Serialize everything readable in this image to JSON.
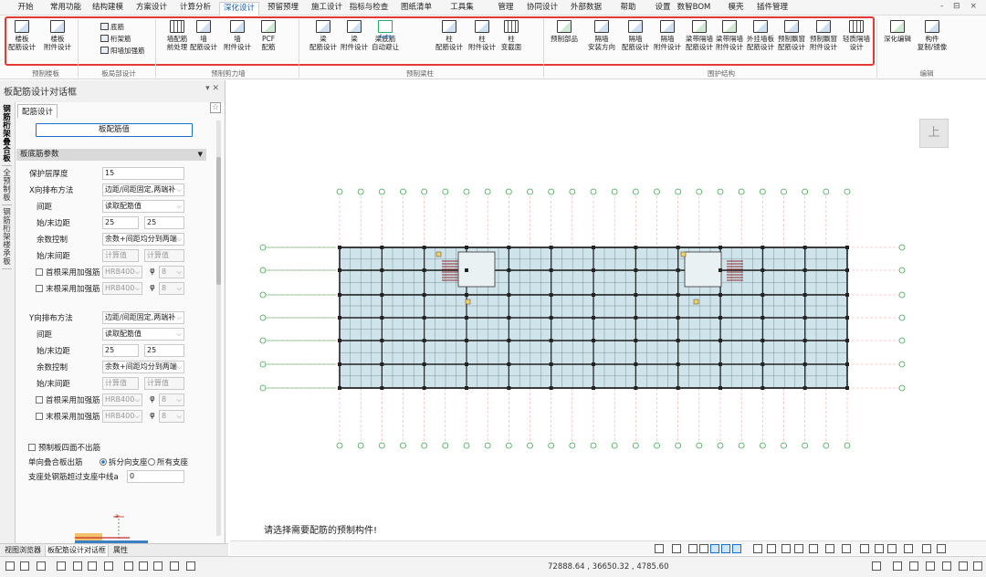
{
  "menu": {
    "tabs": [
      "开始",
      "常用功能",
      "结构建模",
      "方案设计",
      "计算分析",
      "深化设计",
      "预留预埋",
      "施工设计",
      "指标与检查",
      "图纸清单",
      "工具集",
      "管理",
      "协同设计",
      "外部数据",
      "帮助",
      "设置",
      "数智BOM",
      "模壳",
      "插件管理"
    ],
    "active_index": 5
  },
  "ribbon": {
    "buttons": [
      "楼板\n配筋设计",
      "楼板\n附件设计",
      "墙配筋\n前处理",
      "墙\n配筋设计",
      "墙\n附件设计",
      "PCF\n配筋",
      "梁\n配筋设计",
      "梁\n附件设计",
      "梁底筋\n自动避让",
      "柱\n配筋设计",
      "柱\n附件设计",
      "柱\n变截面",
      "预制部品",
      "隔墙\n安装方向",
      "隔墙\n配筋设计",
      "隔墙\n附件设计",
      "梁带隔墙\n配筋设计",
      "梁带隔墙\n附件设计",
      "外挂墙板\n配筋设计",
      "预制飘窗\n配筋设计",
      "预制飘窗\n附件设计",
      "轻质隔墙\n设计",
      "深化编辑",
      "构件\n复制/镜像"
    ],
    "small_buttons": [
      "底筋",
      "桁架筋",
      "阳墙加强筋"
    ],
    "auto_badge": "Auto",
    "groups": [
      "预制楼板",
      "板局部设计",
      "预制剪力墙",
      "预制梁柱",
      "围护结构",
      "编辑"
    ]
  },
  "panel": {
    "title": "板配筋设计对话框",
    "vertical_tabs": [
      "钢筋桁架叠合板",
      "全预制板",
      "钢筋桁架楼承板"
    ],
    "subtab": "配筋设计",
    "top_button": "板配筋值",
    "section": "板底筋参数",
    "fields": {
      "cover_label": "保护层厚度",
      "cover_value": "15",
      "x_method_label": "X向排布方法",
      "x_method_value": "边距/间距固定,两端补",
      "x_spacing_label": "间距",
      "x_spacing_value": "读取配筋值",
      "x_edge_label": "始/末边距",
      "x_edge_start": "25",
      "x_edge_end": "25",
      "x_rem_label": "余数控制",
      "x_rem_value": "余数+间距均分到两端",
      "x_se_spacing_label": "始/末间距",
      "x_se_spacing_a": "计算值",
      "x_se_spacing_b": "计算值",
      "x_first_label": "首根采用加强筋",
      "x_first_grade": "HRB400",
      "x_first_dia": "8",
      "x_last_label": "末根采用加强筋",
      "x_last_grade": "HRB400",
      "x_last_dia": "8",
      "y_method_label": "Y向排布方法",
      "y_method_value": "边距/间距固定,两端补",
      "y_spacing_label": "间距",
      "y_spacing_value": "读取配筋值",
      "y_edge_label": "始/末边距",
      "y_edge_start": "25",
      "y_edge_end": "25",
      "y_rem_label": "余数控制",
      "y_rem_value": "余数+间距均分到两端",
      "y_se_spacing_label": "始/末间距",
      "y_se_spacing_a": "计算值",
      "y_se_spacing_b": "计算值",
      "y_first_label": "首根采用加强筋",
      "y_first_grade": "HRB400",
      "y_first_dia": "8",
      "y_last_label": "末根采用加强筋",
      "y_last_grade": "HRB400",
      "y_last_dia": "8",
      "no_bar_label": "预制板四面不出筋",
      "oneway_label": "单向叠合板出筋",
      "opt_split": "拆分向支座",
      "opt_all": "所有支座",
      "exceed_label": "支座处钢筋超过支座中线a",
      "exceed_value": "0",
      "phi": "φ",
      "diag_label": "a"
    }
  },
  "bottom_tabs": [
    "视图浏览器",
    "板配筋设计对话框",
    "属性"
  ],
  "prompt": "请选择需要配筋的预制构件!",
  "coords": "72888.64 , 36650.32 , 4785.60",
  "viewcube": "上",
  "window_controls": "- ⊟ ×"
}
